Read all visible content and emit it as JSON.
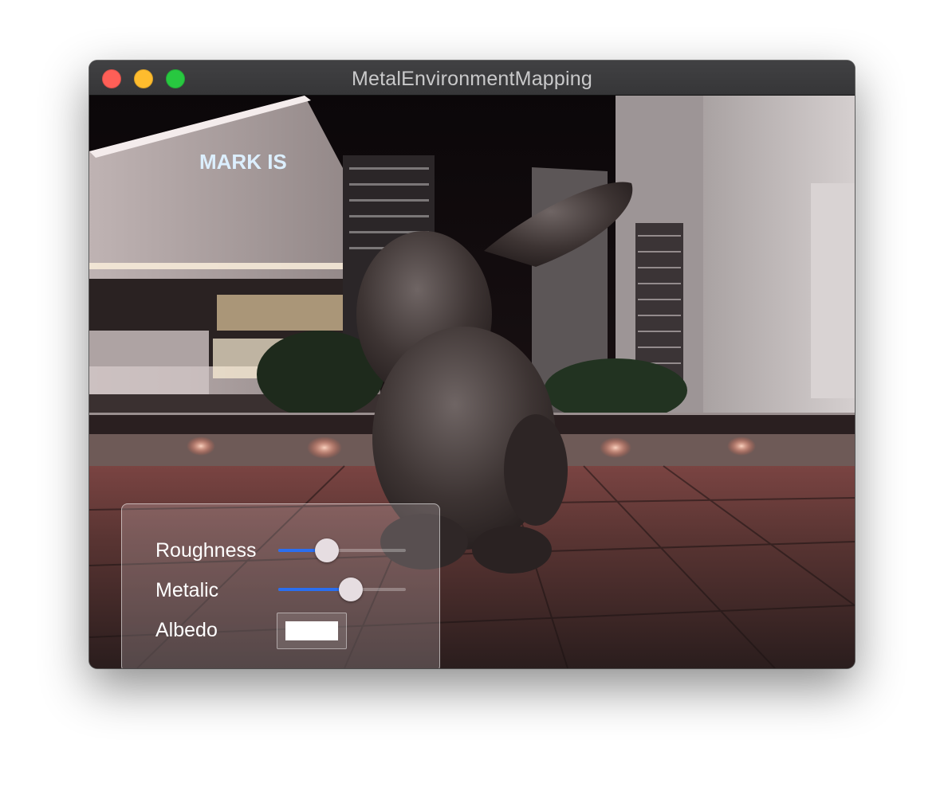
{
  "window": {
    "title": "MetalEnvironmentMapping"
  },
  "scene": {
    "building_sign": "MARK IS"
  },
  "controls": {
    "roughness": {
      "label": "Roughness",
      "value": 0.38
    },
    "metalic": {
      "label": "Metalic",
      "value": 0.57
    },
    "albedo": {
      "label": "Albedo",
      "color": "#ffffff"
    }
  },
  "colors": {
    "slider_fill": "#2a6ef0",
    "close": "#fe5f57",
    "minimize": "#febc2e",
    "zoom": "#28c840"
  }
}
